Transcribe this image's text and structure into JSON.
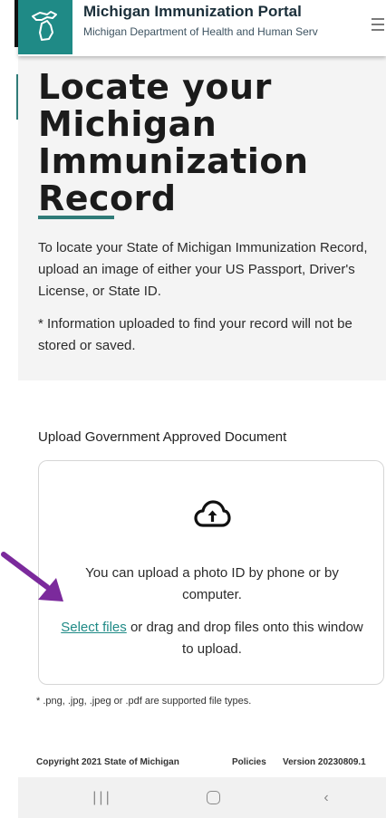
{
  "header": {
    "title": "Michigan Immunization Portal",
    "subtitle": "Michigan Department of Health and Human Serv"
  },
  "hero": {
    "title": "Locate your Michigan Immunization Record",
    "paragraph1": "To locate your State of Michigan Immunization Record, upload an image of either your US Passport, Driver's License, or State ID.",
    "paragraph2": "* Information uploaded to find your record will not be stored or saved."
  },
  "upload": {
    "label": "Upload Government Approved Document",
    "instruction": "You can upload a photo ID by phone or by computer.",
    "select_link": "Select files",
    "drag_text": " or drag and drop files onto this window to upload.",
    "file_types": "* .png, .jpg, .jpeg or .pdf are supported file types."
  },
  "footer": {
    "copyright": "Copyright 2021 State of Michigan",
    "policies": "Policies",
    "version": "Version 20230809.1"
  },
  "colors": {
    "accent": "#1f8a86",
    "arrow": "#7b2a9c"
  }
}
